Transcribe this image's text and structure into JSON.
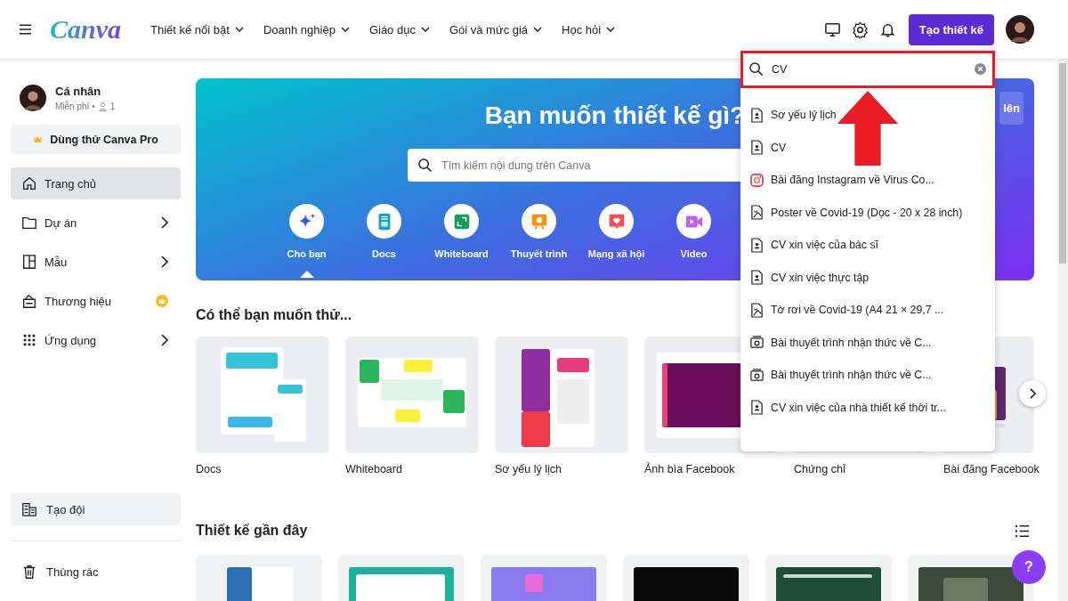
{
  "header": {
    "logo": "Canva",
    "nav": [
      {
        "label": "Thiết kế nổi bật"
      },
      {
        "label": "Doanh nghiệp"
      },
      {
        "label": "Giáo dục"
      },
      {
        "label": "Gói và mức giá"
      },
      {
        "label": "Học hỏi"
      }
    ],
    "create_button": "Tạo thiết kế"
  },
  "sidebar": {
    "profile": {
      "name": "Cá nhân",
      "plan": "Miễn phí •",
      "members": "1"
    },
    "pro_button": "Dùng thử Canva Pro",
    "items": [
      {
        "label": "Trang chủ",
        "selected": true,
        "kind": "plain"
      },
      {
        "label": "Dự án",
        "selected": false,
        "kind": "submenu"
      },
      {
        "label": "Mẫu",
        "selected": false,
        "kind": "submenu"
      },
      {
        "label": "Thương hiệu",
        "selected": false,
        "kind": "premium"
      },
      {
        "label": "Ứng dụng",
        "selected": false,
        "kind": "submenu"
      }
    ],
    "bottom_items": [
      {
        "label": "Tạo đội"
      },
      {
        "label": "Thùng rác"
      }
    ]
  },
  "hero": {
    "title": "Bạn muốn thiết kế gì?",
    "search": {
      "placeholder": "Tìm kiếm nội dung trên Canva"
    },
    "upload_button": "lên",
    "categories": [
      {
        "label": "Cho bạn",
        "selected": true
      },
      {
        "label": "Docs",
        "selected": false
      },
      {
        "label": "Whiteboard",
        "selected": false
      },
      {
        "label": "Thuyết trình",
        "selected": false
      },
      {
        "label": "Mạng xã hội",
        "selected": false
      },
      {
        "label": "Video",
        "selected": false
      }
    ]
  },
  "suggestions": {
    "title": "Có thể bạn muốn thử...",
    "cards": [
      {
        "label": "Docs"
      },
      {
        "label": "Whiteboard"
      },
      {
        "label": "Sơ yếu lý lịch"
      },
      {
        "label": "Ảnh bìa Facebook"
      },
      {
        "label": "Chứng chỉ"
      },
      {
        "label": "Bài đăng Facebook"
      }
    ]
  },
  "recent": {
    "title": "Thiết kế gần đây"
  },
  "help_button": "?",
  "search_dropdown": {
    "query": "CV",
    "results": [
      {
        "label": "Sơ yếu lý lịch",
        "kind": "document"
      },
      {
        "label": "CV",
        "kind": "document"
      },
      {
        "label": "Bài đăng Instagram về Virus Co...",
        "kind": "instagram"
      },
      {
        "label": "Poster về Covid-19 (Dọc - 20 x 28 inch)",
        "kind": "poster"
      },
      {
        "label": "CV xin việc của bác sĩ",
        "kind": "document"
      },
      {
        "label": "CV xin việc thực tập",
        "kind": "document"
      },
      {
        "label": "Tờ rơi về Covid-19 (A4 21 × 29,7 ...",
        "kind": "poster"
      },
      {
        "label": "Bài thuyết trình nhận thức về C...",
        "kind": "presentation"
      },
      {
        "label": "Bài thuyết trình nhận thức về C...",
        "kind": "presentation"
      },
      {
        "label": "CV xin việc của nhà thiết kế thời tr...",
        "kind": "document"
      }
    ]
  }
}
